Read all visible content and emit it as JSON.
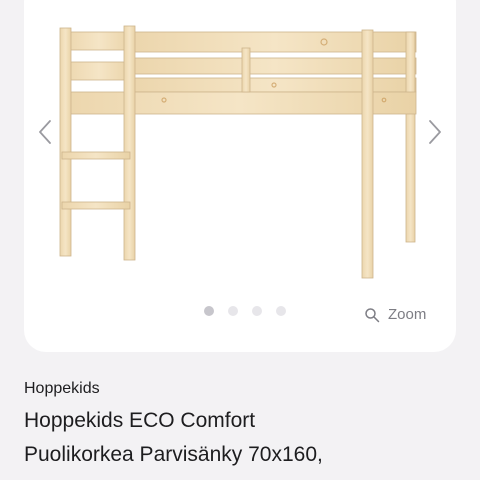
{
  "gallery": {
    "image_alt": "Hoppekids ECO Comfort loft bed",
    "prev_icon": "chevron-left-icon",
    "next_icon": "chevron-right-icon",
    "slide_count": 4,
    "active_slide": 1,
    "zoom_icon": "magnifier-icon",
    "zoom_label": "Zoom"
  },
  "product": {
    "brand": "Hoppekids",
    "title_line1": "Hoppekids ECO Comfort",
    "title_line2": "Puolikorkea Parvisänky 70x160,"
  },
  "colors": {
    "background": "#f3f2f4",
    "card": "#ffffff",
    "wood": "#efdcb8",
    "text": "#1d1d1f"
  }
}
